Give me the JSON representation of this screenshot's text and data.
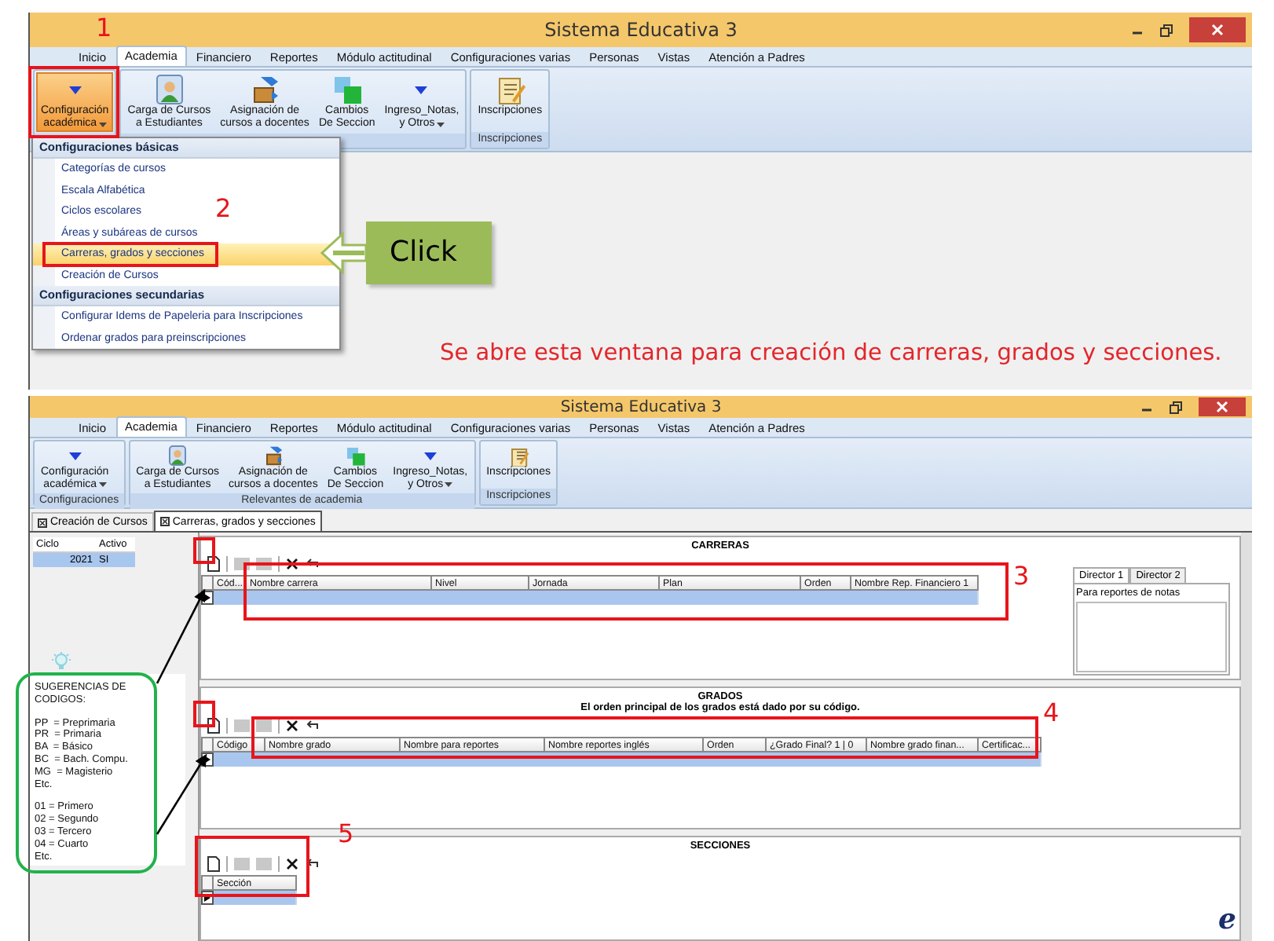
{
  "main_window": {
    "title": "Sistema Educativa 3",
    "tabs": [
      {
        "label": "Inicio",
        "selected": false
      },
      {
        "label": "Academia",
        "selected": true
      },
      {
        "label": "Financiero",
        "selected": false
      },
      {
        "label": "Reportes",
        "selected": false
      },
      {
        "label": "Módulo actitudinal",
        "selected": false
      },
      {
        "label": "Configuraciones varias",
        "selected": false
      },
      {
        "label": "Personas",
        "selected": false
      },
      {
        "label": "Vistas",
        "selected": false
      },
      {
        "label": "Atención a Padres",
        "selected": false
      }
    ],
    "ribbon": [
      {
        "buttons": [
          {
            "lines": [
              "Configuración",
              "académica"
            ],
            "kind": "dropdown",
            "pressed": true
          }
        ]
      },
      {
        "buttons": [
          {
            "lines": [
              "Carga de Cursos",
              "a Estudiantes"
            ],
            "kind": "student-card",
            "pressed": false
          },
          {
            "lines": [
              "Asignación de",
              "cursos a docentes"
            ],
            "kind": "box-transfer",
            "pressed": false
          },
          {
            "lines": [
              "Cambios",
              "De Seccion"
            ],
            "kind": "square-swap",
            "pressed": false
          },
          {
            "lines": [
              "Ingreso_Notas,",
              "y Otros"
            ],
            "kind": "dropdown",
            "pressed": false
          }
        ]
      },
      {
        "label": "Inscripciones",
        "buttons": [
          {
            "lines": [
              "Inscripciones"
            ],
            "kind": "notepad",
            "pressed": false
          }
        ]
      }
    ]
  },
  "dropdown_menu": {
    "sections": [
      {
        "heading": "Configuraciones básicas",
        "items": [
          {
            "label": "Categorías de cursos",
            "selected": false
          },
          {
            "label": "Escala Alfabética",
            "selected": false
          },
          {
            "label": "Ciclos escolares",
            "selected": false
          },
          {
            "label": "Áreas y subáreas de cursos",
            "selected": false
          },
          {
            "label": "Carreras, grados y secciones",
            "selected": true
          },
          {
            "label": "Creación de Cursos",
            "selected": false
          }
        ]
      },
      {
        "heading": "Configuraciones secundarias",
        "items": [
          {
            "label": "Configurar Idems de Papeleria para Inscripciones",
            "selected": false
          },
          {
            "label": "Ordenar grados para preinscripciones",
            "selected": false
          }
        ]
      }
    ]
  },
  "annotations": {
    "steps": [
      "1",
      "2",
      "3",
      "4",
      "5"
    ],
    "callout": "Click",
    "caption": "Se abre esta ventana para creación de carreras, grados y secciones."
  },
  "second_window": {
    "title": "Sistema Educativa 3",
    "tabs": [
      {
        "label": "Inicio",
        "selected": false
      },
      {
        "label": "Academia",
        "selected": true
      },
      {
        "label": "Financiero",
        "selected": false
      },
      {
        "label": "Reportes",
        "selected": false
      },
      {
        "label": "Módulo actitudinal",
        "selected": false
      },
      {
        "label": "Configuraciones varias",
        "selected": false
      },
      {
        "label": "Personas",
        "selected": false
      },
      {
        "label": "Vistas",
        "selected": false
      },
      {
        "label": "Atención a Padres",
        "selected": false
      }
    ],
    "ribbon": [
      {
        "label": "Configuraciones",
        "buttons": [
          {
            "lines": [
              "Configuración",
              "académica"
            ],
            "kind": "dropdown",
            "pressed": false
          }
        ]
      },
      {
        "label": "Relevantes de academia",
        "buttons": [
          {
            "lines": [
              "Carga de Cursos",
              "a Estudiantes"
            ],
            "kind": "student-card",
            "pressed": false
          },
          {
            "lines": [
              "Asignación de",
              "cursos a docentes"
            ],
            "kind": "box-transfer",
            "pressed": false
          },
          {
            "lines": [
              "Cambios",
              "De Seccion"
            ],
            "kind": "square-swap",
            "pressed": false
          },
          {
            "lines": [
              "Ingreso_Notas,",
              "y Otros"
            ],
            "kind": "dropdown",
            "pressed": false
          }
        ]
      },
      {
        "label": "Inscripciones",
        "buttons": [
          {
            "lines": [
              "Inscripciones"
            ],
            "kind": "notepad",
            "pressed": false
          }
        ]
      }
    ],
    "document_tabs": [
      {
        "label": "Creación de Cursos",
        "selected": false
      },
      {
        "label": "Carreras, grados y secciones",
        "selected": true
      }
    ],
    "cycles": {
      "columns": [
        "Ciclo",
        "Activo"
      ],
      "rows": [
        [
          "2021",
          "SI"
        ]
      ]
    },
    "hint": {
      "title_lines": [
        "SUGERENCIAS DE",
        "CODIGOS:"
      ],
      "groups": [
        [
          "PP  = Preprimaria",
          "PR  = Primaria",
          "BA  = Básico",
          "BC  = Bach. Compu.",
          "MG  = Magisterio",
          "Etc."
        ],
        [
          "01 = Primero",
          "02 = Segundo",
          "03 = Tercero",
          "04 = Cuarto",
          "Etc."
        ]
      ]
    },
    "carreras": {
      "title": "CARRERAS",
      "columns": [
        "Cód...",
        "Nombre carrera",
        "Nivel",
        "Jornada",
        "Plan",
        "Orden",
        "Nombre Rep. Financiero 1"
      ]
    },
    "director_tabs": [
      {
        "label": "Director 1",
        "selected": true
      },
      {
        "label": "Director 2",
        "selected": false
      }
    ],
    "director_caption": "Para reportes de notas",
    "grados": {
      "title": "GRADOS",
      "subtitle": "El orden principal de los grados está dado por su código.",
      "columns": [
        "Código",
        "Nombre grado",
        "Nombre para reportes",
        "Nombre reportes inglés",
        "Orden",
        "¿Grado Final? 1  |  0",
        "Nombre grado finan...",
        "Certificac..."
      ]
    },
    "secciones": {
      "title": "SECCIONES",
      "columns": [
        "Sección"
      ]
    },
    "corner_logo": "e"
  }
}
